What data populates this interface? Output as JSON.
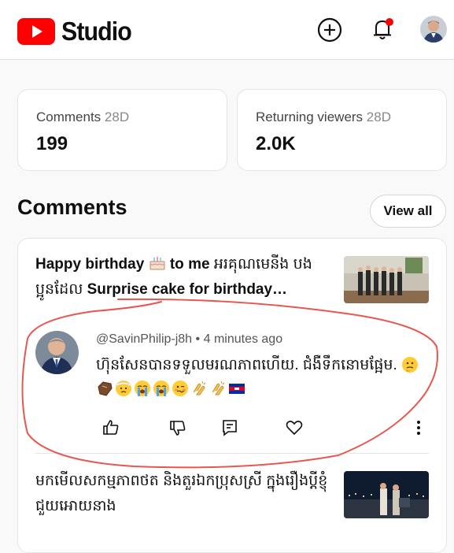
{
  "header": {
    "app_name": "Studio",
    "brand_color": "#ff0000"
  },
  "stats": [
    {
      "label": "Comments",
      "period": "28D",
      "value": "199"
    },
    {
      "label": "Returning viewers",
      "period": "28D",
      "value": "2.0K"
    }
  ],
  "comments_section": {
    "title": "Comments",
    "view_all_label": "View all",
    "video1": {
      "title_part1": "Happy birthday ",
      "title_part2": " to me ",
      "title_part3": "អរគុណមេនីង បងប្អូនដែល ",
      "title_part4": "Surprise cake for birthday…"
    },
    "comment": {
      "author": "@SavinPhilip-j8h",
      "separator": "•",
      "time": "4 minutes ago",
      "text": "ហ៊ុនសែនបានទទួលមរណភាពហើយ. ជំងឺទឹកនោមផ្អែម. ",
      "emojis": [
        "thinking-face",
        "coffin",
        "face-with-head-bandage",
        "loudly-crying-face",
        "loudly-crying-face",
        "woozy-face",
        "clapping-hands",
        "clapping-hands",
        "cambodia-flag"
      ]
    },
    "video2": {
      "title": "មកមើលសកម្មភាពថត និងតួរឯកប្រុសស្រី ក្នុងរឿងប្ដីខ្ញុំជួយអោយនាង"
    }
  },
  "annotation_color": "#e8574f"
}
